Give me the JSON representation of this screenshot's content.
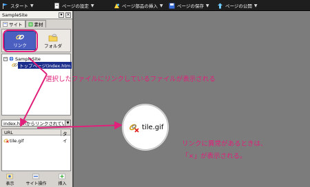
{
  "toolbar": {
    "items": [
      {
        "label": "スタート",
        "icon": "flag-icon"
      },
      {
        "label": "ページの設定",
        "icon": "page-settings-icon"
      },
      {
        "label": "ページ部品の挿入",
        "icon": "insert-part-icon"
      },
      {
        "label": "ページの保存",
        "icon": "save-icon"
      },
      {
        "label": "ページの公開",
        "icon": "publish-icon"
      }
    ]
  },
  "panel": {
    "title": "SampleSite",
    "close": "×",
    "tabs": [
      "サイト",
      "素材"
    ],
    "buttons": {
      "link": "リンク",
      "folder": "フォルダ"
    },
    "tree": {
      "root": "SampleSite",
      "page": "トップページ(index.htm"
    },
    "select": "index.htmからリンクされているファ",
    "filelist": {
      "col_url": "URL",
      "col_type": "タイ",
      "file": "tile.gif"
    },
    "bottom": [
      "表示",
      "サイト操作",
      "挿入"
    ]
  },
  "callouts": {
    "top": "選択したファイルにリンクしているファイルが表示される",
    "bottom_line1": "リンクに異常があるときは、",
    "bottom_line2": "「×」が表示される。"
  },
  "magnifier": {
    "file": "tile.gif"
  },
  "colors": {
    "accent": "#e0207a",
    "selection": "#1c2e8c",
    "workspace": "#7c7c7c"
  }
}
